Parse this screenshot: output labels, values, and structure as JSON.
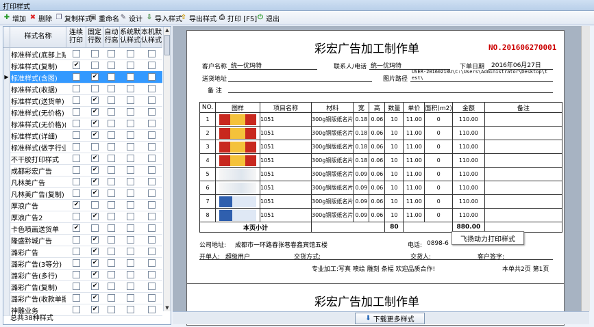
{
  "window": {
    "title": "打印样式"
  },
  "toolbar": {
    "add": "增加",
    "delete": "删除",
    "copy_style": "复制样式",
    "rename": "重命名",
    "design": "设计",
    "import_style": "导入样式",
    "export_style": "导出样式",
    "print": "打印 [F5]",
    "exit": "退出"
  },
  "grid": {
    "headers": [
      "样式名称",
      "连续\n打印",
      "固定\n行数",
      "自动\n行高",
      "系统默\n认样式",
      "本机默\n认样式"
    ],
    "rows": [
      {
        "name": "标准样式(底部上贴",
        "c": [
          false,
          false,
          false,
          false,
          false
        ]
      },
      {
        "name": "标准样式(复制)",
        "c": [
          true,
          false,
          false,
          false,
          false
        ]
      },
      {
        "name": "标准样式(含图)",
        "c": [
          false,
          true,
          false,
          false,
          false
        ],
        "selected": true
      },
      {
        "name": "标准样式(收据)",
        "c": [
          false,
          false,
          false,
          false,
          false
        ]
      },
      {
        "name": "标准样式(送货单)",
        "c": [
          false,
          true,
          false,
          false,
          false
        ]
      },
      {
        "name": "标准样式(无价格)",
        "c": [
          false,
          true,
          false,
          false,
          false
        ]
      },
      {
        "name": "标准样式(无价格)(",
        "c": [
          false,
          true,
          false,
          false,
          false
        ]
      },
      {
        "name": "标准样式(详细)",
        "c": [
          false,
          true,
          false,
          false,
          false
        ]
      },
      {
        "name": "标准样式(做字行业",
        "c": [
          false,
          false,
          false,
          false,
          false
        ]
      },
      {
        "name": "不干胶打印样式",
        "c": [
          false,
          true,
          false,
          false,
          false
        ]
      },
      {
        "name": "成都彩宏广告",
        "c": [
          false,
          true,
          false,
          false,
          false
        ]
      },
      {
        "name": "凡林美广告",
        "c": [
          false,
          true,
          false,
          false,
          false
        ]
      },
      {
        "name": "凡林美广告(复制)",
        "c": [
          false,
          true,
          false,
          false,
          false
        ]
      },
      {
        "name": "厚浪广告",
        "c": [
          true,
          false,
          false,
          false,
          false
        ]
      },
      {
        "name": "厚浪广告2",
        "c": [
          false,
          true,
          false,
          false,
          false
        ]
      },
      {
        "name": "卡色喷画送货单",
        "c": [
          true,
          false,
          false,
          false,
          false
        ]
      },
      {
        "name": "隆盛黔城广告",
        "c": [
          false,
          true,
          false,
          false,
          false
        ]
      },
      {
        "name": "潞彩广告",
        "c": [
          false,
          true,
          false,
          false,
          false
        ]
      },
      {
        "name": "潞彩广告(3等分)",
        "c": [
          false,
          true,
          false,
          false,
          false
        ]
      },
      {
        "name": "潞彩广告(多行)",
        "c": [
          false,
          true,
          false,
          false,
          false
        ]
      },
      {
        "name": "潞彩广告(复制)",
        "c": [
          false,
          true,
          false,
          false,
          false
        ]
      },
      {
        "name": "潞彩广告(收款单据",
        "c": [
          false,
          true,
          false,
          false,
          false
        ]
      },
      {
        "name": "神雕业务",
        "c": [
          false,
          true,
          false,
          false,
          false
        ]
      }
    ],
    "total": "总共38种样式"
  },
  "doc": {
    "title": "彩宏广告加工制作单",
    "order_no": "NO.201606270001",
    "customer_label": "客户名称",
    "customer": "统一优玛特",
    "contact_label": "联系人/电话",
    "contact": "统一优玛特",
    "order_date_label": "下单日期",
    "order_date": "2016年06月27日",
    "address_label": "送货地址",
    "image_path_label": "图片路径",
    "image_path": "USER-20160210U\\C:\\Users\\Administrator\\Desktop\\test\\",
    "note_label": "备  注",
    "table_headers": [
      "NO.",
      "图样",
      "项目名称",
      "材料",
      "宽",
      "高",
      "数量",
      "单价",
      "面积(m2)",
      "金额",
      "备注"
    ],
    "items": [
      {
        "no": "1",
        "name": "1051",
        "material": "300g铜版纸名片",
        "w": "0.18",
        "h": "0.06",
        "qty": "10",
        "price": "11.00",
        "area": "0",
        "amount": "110.00",
        "img": "red"
      },
      {
        "no": "2",
        "name": "1051",
        "material": "300g铜版纸名片",
        "w": "0.18",
        "h": "0.06",
        "qty": "10",
        "price": "11.00",
        "area": "0",
        "amount": "110.00",
        "img": "red"
      },
      {
        "no": "3",
        "name": "1051",
        "material": "300g铜版纸名片",
        "w": "0.18",
        "h": "0.06",
        "qty": "10",
        "price": "11.00",
        "area": "0",
        "amount": "110.00",
        "img": "red"
      },
      {
        "no": "4",
        "name": "1051",
        "material": "300g铜版纸名片",
        "w": "0.18",
        "h": "0.06",
        "qty": "10",
        "price": "11.00",
        "area": "0",
        "amount": "110.00",
        "img": "red"
      },
      {
        "no": "5",
        "name": "1051",
        "material": "300g铜版纸名片",
        "w": "0.09",
        "h": "0.06",
        "qty": "10",
        "price": "11.00",
        "area": "0",
        "amount": "110.00",
        "img": "white"
      },
      {
        "no": "6",
        "name": "1051",
        "material": "300g铜版纸名片",
        "w": "0.09",
        "h": "0.06",
        "qty": "10",
        "price": "11.00",
        "area": "0",
        "amount": "110.00",
        "img": "white"
      },
      {
        "no": "7",
        "name": "1051",
        "material": "300g铜版纸名片",
        "w": "0.09",
        "h": "0.06",
        "qty": "10",
        "price": "11.00",
        "area": "0",
        "amount": "110.00",
        "img": "blue"
      },
      {
        "no": "8",
        "name": "1051",
        "material": "300g铜版纸名片",
        "w": "0.09",
        "h": "0.06",
        "qty": "10",
        "price": "11.00",
        "area": "0",
        "amount": "110.00",
        "img": "blue"
      }
    ],
    "subtotal_label": "本页小计",
    "subtotal_qty": "80",
    "subtotal_amount": "880.00",
    "company_addr_label": "公司地址:",
    "company_addr": "成都市一环路春张巷春鑫宾馆五楼",
    "phone_label": "电话:",
    "phone": "0898-6",
    "issuer_label": "开单人:",
    "issuer": "超级用户",
    "payment_label": "交货方式:",
    "receiver_label": "交货人:",
    "customer_sign_label": "客户签字:",
    "slogan": "专业加工:写真  喷绘  雕刻  条幅  欢迎品质合作!",
    "page_info": "本单共2页  第1页"
  },
  "tooltip": "飞扬动力打印样式",
  "bottom": {
    "download": "下载更多样式"
  },
  "colors": {
    "title_red": "#cc0000",
    "selected_row": "#3399ff"
  }
}
